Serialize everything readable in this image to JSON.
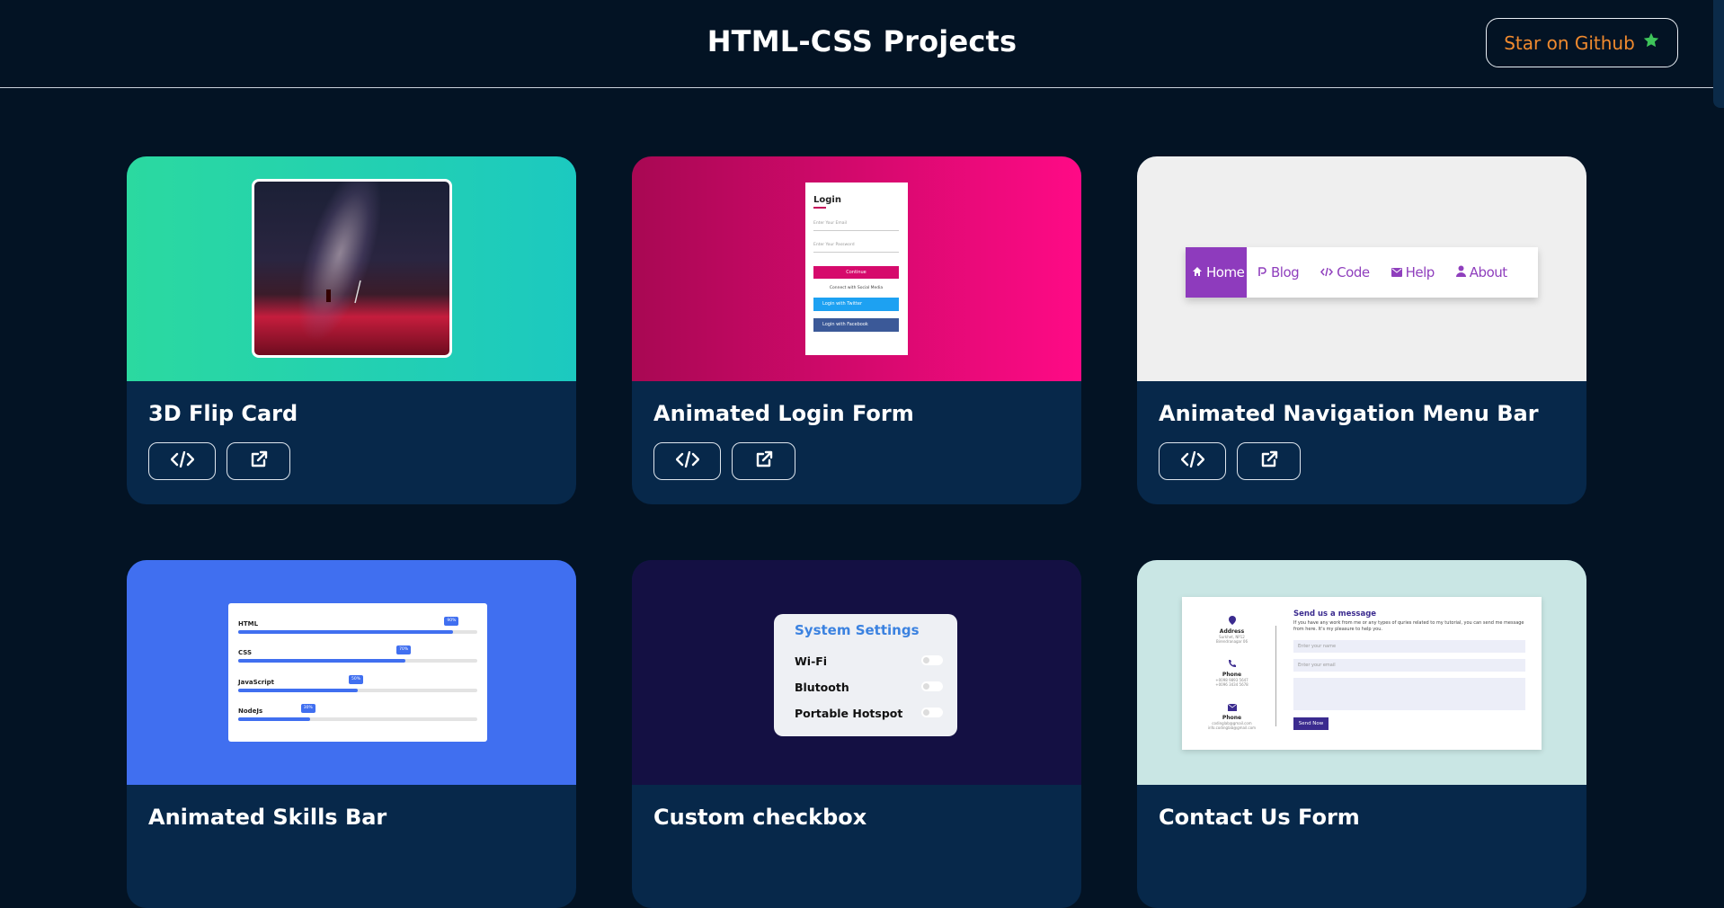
{
  "header": {
    "title": "HTML-CSS Projects",
    "star_label": "Star on Github",
    "colors": {
      "background": "#031324",
      "star_text": "#f08a2e",
      "star_icon": "#3ec45a"
    }
  },
  "cards": [
    {
      "title": "3D Flip Card"
    },
    {
      "title": "Animated Login Form"
    },
    {
      "title": "Animated Navigation Menu Bar"
    },
    {
      "title": "Animated Skills Bar"
    },
    {
      "title": "Custom checkbox"
    },
    {
      "title": "Contact Us Form"
    }
  ],
  "login_preview": {
    "title": "Login",
    "email_placeholder": "Enter Your Email",
    "password_placeholder": "Enter Your Password",
    "continue": "Continue",
    "or": "Connect with Social Media",
    "twitter": "Login with Twitter",
    "facebook": "Login with Facebook"
  },
  "nav_preview": {
    "items": [
      "Home",
      "Blog",
      "Code",
      "Help",
      "About"
    ],
    "active": "Home"
  },
  "skills_preview": {
    "skills": [
      {
        "name": "HTML",
        "percent": 90,
        "label": "90%"
      },
      {
        "name": "CSS",
        "percent": 70,
        "label": "70%"
      },
      {
        "name": "JavaScript",
        "percent": 50,
        "label": "50%"
      },
      {
        "name": "NodeJs",
        "percent": 30,
        "label": "30%"
      }
    ]
  },
  "settings_preview": {
    "title": "System Settings",
    "rows": [
      "Wi-Fi",
      "Blutooth",
      "Portable Hotspot"
    ]
  },
  "contact_preview": {
    "address_label": "Address",
    "address_lines": [
      "Surkhet, NP12",
      "Birendranagar 06"
    ],
    "phone_label": "Phone",
    "phone_lines": [
      "+0098 9893 5647",
      "+0096 3434 5678"
    ],
    "email_label": "Phone",
    "email_lines": [
      "codinglab@gmail.com",
      "info.codinglab@gmail.com"
    ],
    "heading": "Send us a message",
    "description": "If you have any work from me or any types of quries related to my tutorial, you can send me message from here. It's my pleasure to help you.",
    "name_placeholder": "Enter your name",
    "email_placeholder": "Enter your email",
    "send": "Send Now"
  }
}
